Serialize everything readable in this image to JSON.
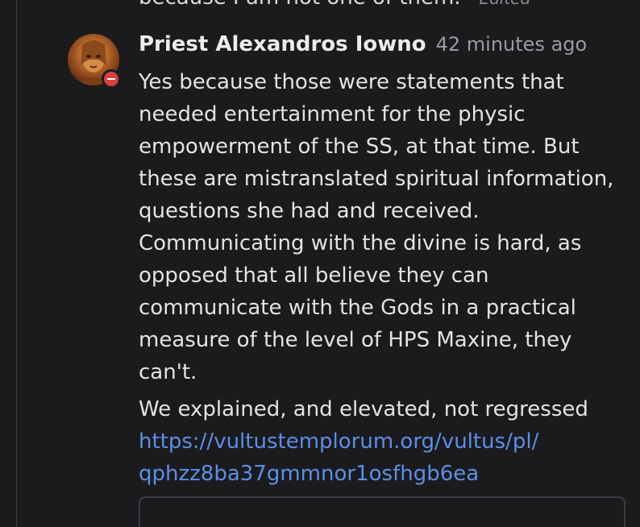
{
  "previous_comment": {
    "tail_text": "because I am not one of them.",
    "separator": "·",
    "edited_label": "Edited"
  },
  "comment": {
    "author": "Priest Alexandros Iowno",
    "timestamp": "42 minutes ago",
    "avatar_icon": "avatar-image",
    "status_badge_icon": "do-not-disturb-icon",
    "status_color": "#d93f3f",
    "paragraph_1_lines": [
      "Yes because those were statements that",
      "needed entertainment for the physic",
      "empowerment of the SS, at that time. But",
      "these are mistranslated spiritual information,",
      "questions she had and received.",
      "Communicating with the divine is hard, as",
      "opposed that all believe they can",
      "communicate with the Gods in a practical",
      "measure of the level of HPS Maxine, they",
      "can't."
    ],
    "paragraph_2": "We explained, and elevated, not regressed",
    "link_line_1": "https://vultustemplorum.org/vultus/pl/",
    "link_line_2": "qphzz8ba37gmmnor1osfhgb6ea",
    "link_color": "#5c8fe6"
  },
  "reply_box": {
    "placeholder": ""
  }
}
